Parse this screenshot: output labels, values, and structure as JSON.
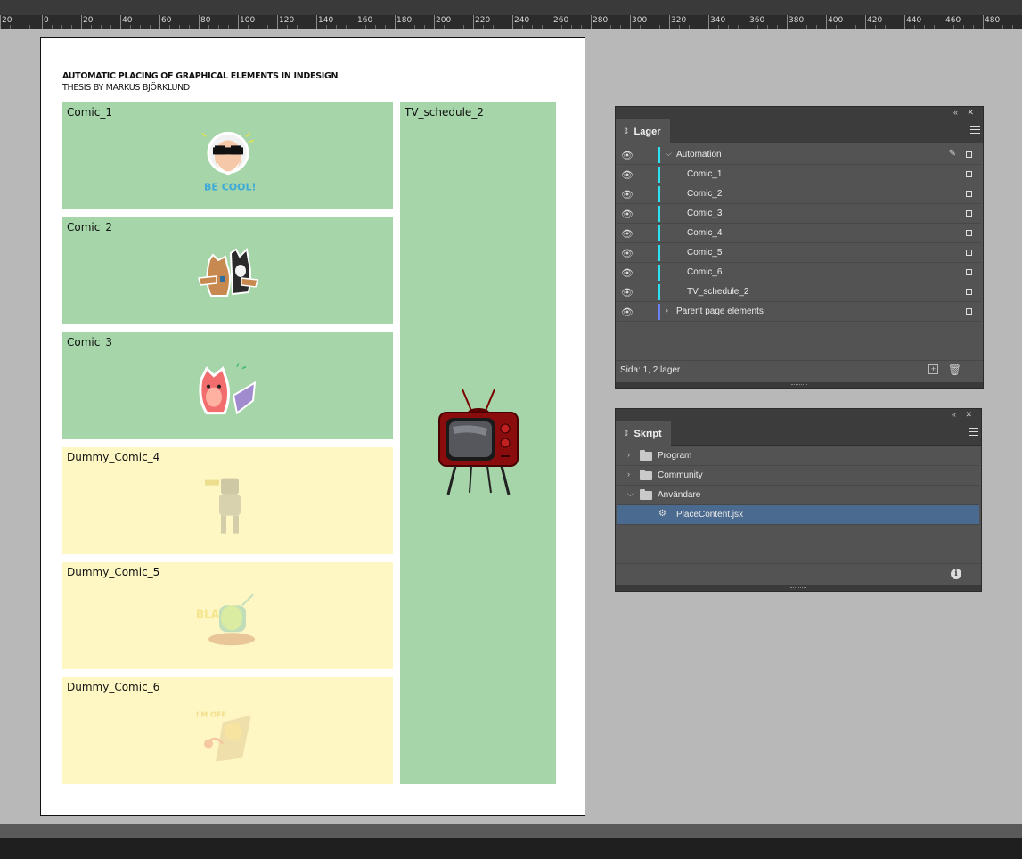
{
  "ruler": {
    "labels": [
      "20",
      "0",
      "20",
      "40",
      "60",
      "80",
      "100",
      "120",
      "140",
      "160",
      "180",
      "200",
      "220",
      "240",
      "260",
      "280",
      "300",
      "320",
      "340",
      "360",
      "380",
      "400",
      "420",
      "440",
      "460",
      "480"
    ]
  },
  "document": {
    "title": "AUTOMATIC PLACING OF GRAPHICAL ELEMENTS IN INDESIGN",
    "subtitle": "THESIS BY MARKUS BJÖRKLUND",
    "frames": [
      {
        "label": "Comic_1",
        "fill": "#a5d5a8",
        "art": "sunglasses-old-man-sticker",
        "art_text": "BE COOL!"
      },
      {
        "label": "Comic_2",
        "fill": "#a5d5a8",
        "art": "hugging-cats-sticker"
      },
      {
        "label": "Comic_3",
        "fill": "#a5d5a8",
        "art": "pink-fox-sticker"
      },
      {
        "label": "Dummy_Comic_4",
        "fill": "#fef7c4",
        "art": "faded-robot-sticker"
      },
      {
        "label": "Dummy_Comic_5",
        "fill": "#fef7c4",
        "art": "faded-alien-sticker"
      },
      {
        "label": "Dummy_Comic_6",
        "fill": "#fef7c4",
        "art": "faded-sunbathing-sticker"
      },
      {
        "label": "TV_schedule_2",
        "fill": "#a5d5a8",
        "art": "retro-tv-illustration"
      }
    ]
  },
  "layers_panel": {
    "tab": "Lager",
    "rows": [
      {
        "name": "Automation",
        "expanded": true,
        "color": "#2ee1f0"
      },
      {
        "name": "Comic_1",
        "color": "#2ee1f0"
      },
      {
        "name": "Comic_2",
        "color": "#2ee1f0"
      },
      {
        "name": "Comic_3",
        "color": "#2ee1f0"
      },
      {
        "name": "Comic_4",
        "color": "#2ee1f0"
      },
      {
        "name": "Comic_5",
        "color": "#2ee1f0"
      },
      {
        "name": "Comic_6",
        "color": "#2ee1f0"
      },
      {
        "name": "TV_schedule_2",
        "color": "#2ee1f0"
      },
      {
        "name": "Parent page elements",
        "expanded": false,
        "color": "#6a82f0"
      }
    ],
    "footer": "Sida: 1, 2 lager"
  },
  "scripts_panel": {
    "tab": "Skript",
    "rows": [
      {
        "name": "Program",
        "type": "folder",
        "expanded": false
      },
      {
        "name": "Community",
        "type": "folder",
        "expanded": false
      },
      {
        "name": "Användare",
        "type": "folder",
        "expanded": true
      },
      {
        "name": "PlaceContent.jsx",
        "type": "script",
        "selected": true
      }
    ]
  },
  "colors": {
    "green_frame": "#a5d5a8",
    "yellow_frame": "#fef7c4",
    "layer_cyan": "#2ee1f0",
    "layer_blue": "#6a82f0",
    "selection": "#4a6a8f"
  }
}
